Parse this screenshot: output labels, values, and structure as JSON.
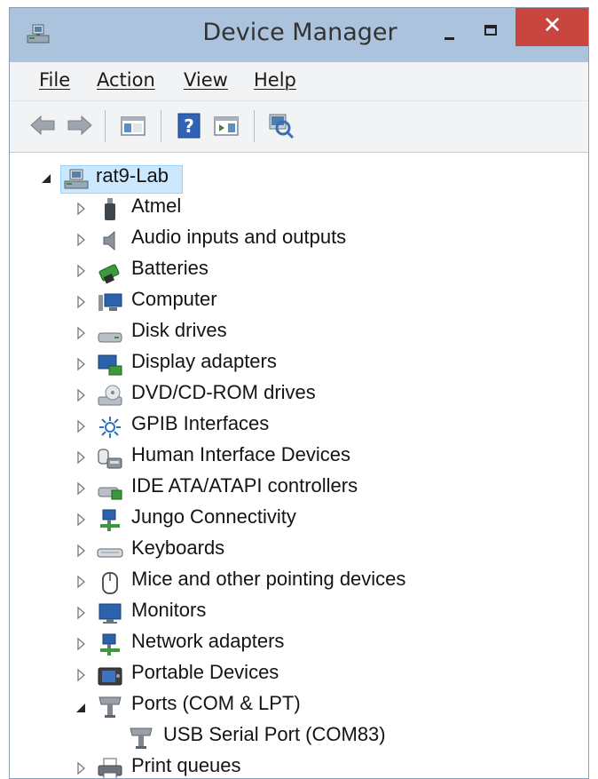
{
  "window": {
    "title": "Device Manager",
    "close_glyph": "✕"
  },
  "menu": {
    "items": [
      {
        "label": "File"
      },
      {
        "label": "Action"
      },
      {
        "label": "View"
      },
      {
        "label": "Help"
      }
    ]
  },
  "toolbar": {
    "buttons": [
      {
        "icon": "back-arrow-icon"
      },
      {
        "icon": "forward-arrow-icon"
      },
      {
        "icon": "show-hide-console-tree-icon"
      },
      {
        "icon": "help-icon"
      },
      {
        "icon": "properties-icon"
      },
      {
        "icon": "scan-hardware-icon"
      }
    ]
  },
  "tree": {
    "root": {
      "label": "rat9-Lab",
      "icon": "computer-network-icon",
      "expanded": true,
      "selected": true
    },
    "categories": [
      {
        "label": "Atmel",
        "icon": "usb-plug-icon",
        "expanded": false
      },
      {
        "label": "Audio inputs and outputs",
        "icon": "speaker-icon",
        "expanded": false
      },
      {
        "label": "Batteries",
        "icon": "battery-icon",
        "expanded": false
      },
      {
        "label": "Computer",
        "icon": "computer-icon",
        "expanded": false
      },
      {
        "label": "Disk drives",
        "icon": "disk-drive-icon",
        "expanded": false
      },
      {
        "label": "Display adapters",
        "icon": "display-adapter-icon",
        "expanded": false
      },
      {
        "label": "DVD/CD-ROM drives",
        "icon": "dvd-drive-icon",
        "expanded": false
      },
      {
        "label": "GPIB Interfaces",
        "icon": "gpib-icon",
        "expanded": false
      },
      {
        "label": "Human Interface Devices",
        "icon": "hid-icon",
        "expanded": false
      },
      {
        "label": "IDE ATA/ATAPI controllers",
        "icon": "ide-controller-icon",
        "expanded": false
      },
      {
        "label": "Jungo Connectivity",
        "icon": "jungo-icon",
        "expanded": false
      },
      {
        "label": "Keyboards",
        "icon": "keyboard-icon",
        "expanded": false
      },
      {
        "label": "Mice and other pointing devices",
        "icon": "mouse-icon",
        "expanded": false
      },
      {
        "label": "Monitors",
        "icon": "monitor-icon",
        "expanded": false
      },
      {
        "label": "Network adapters",
        "icon": "network-adapter-icon",
        "expanded": false
      },
      {
        "label": "Portable Devices",
        "icon": "portable-device-icon",
        "expanded": false
      },
      {
        "label": "Ports (COM & LPT)",
        "icon": "port-connector-icon",
        "expanded": true,
        "children": [
          {
            "label": "USB Serial Port (COM83)",
            "icon": "port-connector-icon"
          }
        ]
      },
      {
        "label": "Print queues",
        "icon": "printer-icon",
        "expanded": false
      }
    ]
  },
  "colors": {
    "titlebar": "#acc3de",
    "close_button": "#c8463d",
    "selection_fill": "#cce8ff",
    "selection_border": "#99d1ff"
  }
}
